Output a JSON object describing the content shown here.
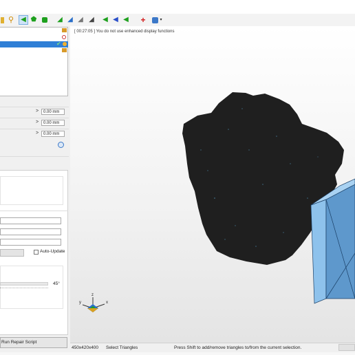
{
  "toolbar": {
    "icons": [
      "folder-icon",
      "search-icon",
      "select-triangle-icon",
      "select-polygon-icon",
      "fill-icon",
      "view-front-icon",
      "view-back-icon",
      "view-left-icon",
      "view-right-icon",
      "view-top-icon",
      "view-bottom-icon",
      "view-iso-icon",
      "arrow-left-icon",
      "arrow-left-blue-icon",
      "arrow-left-green-icon",
      "add-part-icon",
      "repair-wizard-icon",
      "dropdown-icon"
    ],
    "colors": {
      "accent": "#2f7fd6",
      "green": "#1ea01e",
      "red": "#d21919"
    }
  },
  "left_panel": {
    "measure_rows": [
      {
        "value": "0.00 mm"
      },
      {
        "value": "0.00 mm"
      },
      {
        "value": "0.00 mm"
      }
    ],
    "auto_update_label": "Auto-Update",
    "angle_value": "45°",
    "run_repair_label": "Run Repair Script"
  },
  "viewport": {
    "message": "[ 00:27:05 ] You do not use enhanced display functions",
    "axes": {
      "x": "x",
      "y": "y",
      "z": "z"
    }
  },
  "status_bar": {
    "dimensions": "450x420x400",
    "mode": "Select Triangles",
    "hint": "Press Shift to add/remove triangles to/from the current selection."
  }
}
